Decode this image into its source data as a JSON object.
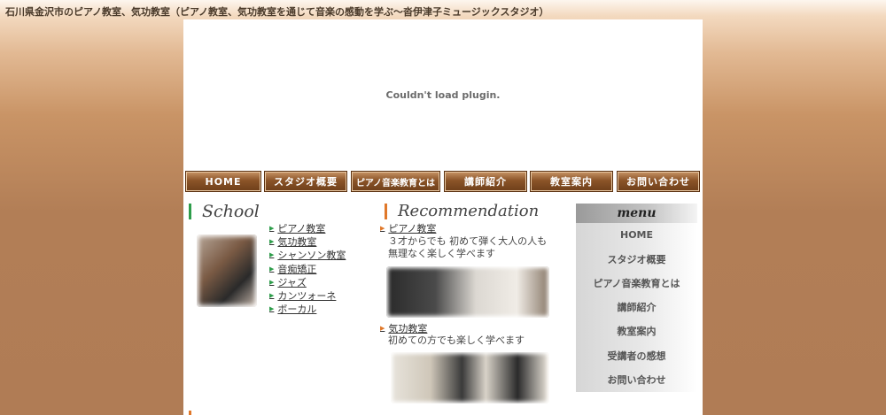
{
  "header": {
    "title": "石川県金沢市のピアノ教室、気功教室（ピアノ教室、気功教室を通じて音楽の感動を学ぶ〜沓伊津子ミュージックスタジオ）"
  },
  "plugin": {
    "message": "Couldn't load plugin."
  },
  "nav": {
    "items": [
      "HOME",
      "スタジオ概要",
      "ピアノ音楽教育とは",
      "講師紹介",
      "教室案内",
      "お問い合わせ"
    ]
  },
  "school": {
    "heading": "School",
    "items": [
      "ピアノ教室",
      "気功教室",
      "シャンソン教室",
      "音痴矯正",
      "ジャズ",
      "カンツォーネ",
      "ボーカル"
    ]
  },
  "recommendation": {
    "heading": "Recommendation",
    "entries": [
      {
        "title": "ピアノ教室",
        "line1": "３才からでも 初めて弾く大人の人も",
        "line2": "無理なく楽しく学べます"
      },
      {
        "title": "気功教室",
        "line1": "初めての方でも楽しく学べます"
      }
    ]
  },
  "menu": {
    "heading": "menu",
    "items": [
      "HOME",
      "スタジオ概要",
      "ピアノ音楽教育とは",
      "講師紹介",
      "教室案内",
      "受講者の感想",
      "お問い合わせ"
    ]
  },
  "colors": {
    "accent_green": "#2e9d4b",
    "accent_orange": "#e0782a",
    "nav_brown": "#8b5428"
  }
}
